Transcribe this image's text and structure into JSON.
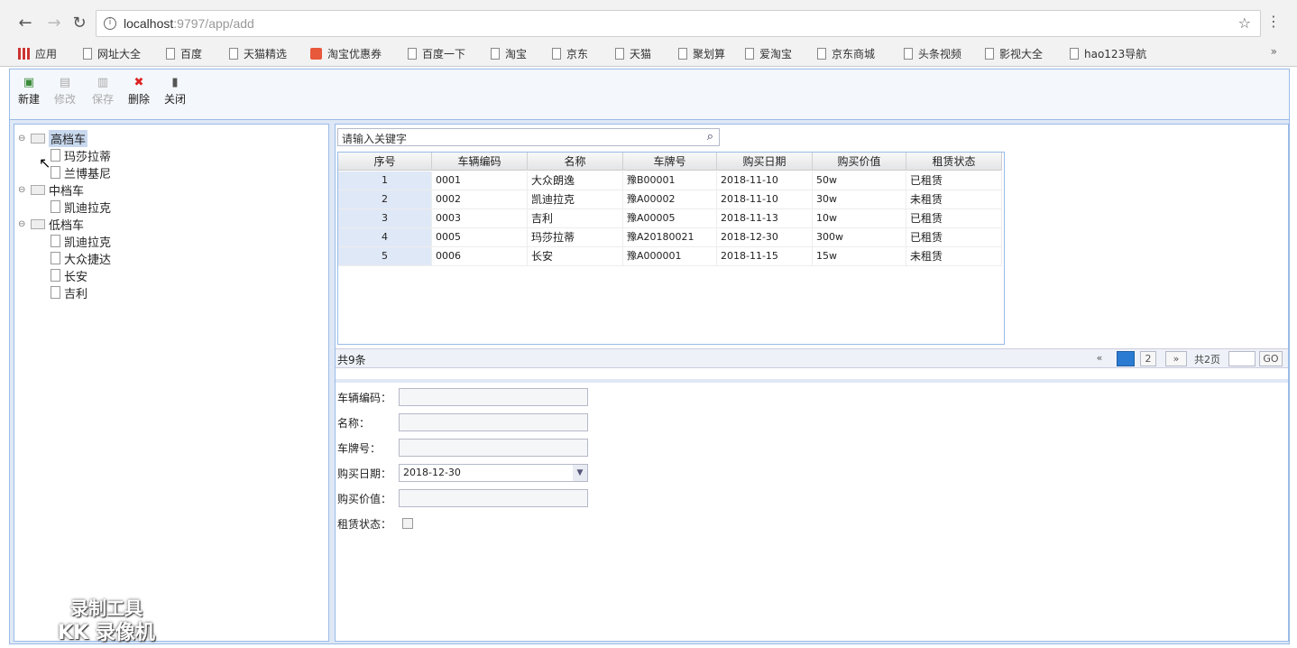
{
  "browser": {
    "url_host": "localhost",
    "url_path": ":9797/app/add",
    "bookmarks": [
      "应用",
      "网址大全",
      "百度",
      "天猫精选",
      "淘宝优惠券",
      "百度一下",
      "淘宝",
      "京东",
      "天猫",
      "聚划算",
      "爱淘宝",
      "京东商城",
      "头条视频",
      "影视大全",
      "hao123导航"
    ],
    "more": "»"
  },
  "toolbar": {
    "new": "新建",
    "edit": "修改",
    "save": "保存",
    "delete": "删除",
    "close": "关闭"
  },
  "tree": {
    "groups": [
      {
        "label": "高档车",
        "items": [
          "玛莎拉蒂",
          "兰博基尼"
        ]
      },
      {
        "label": "中档车",
        "items": [
          "凯迪拉克"
        ]
      },
      {
        "label": "低档车",
        "items": [
          "凯迪拉克",
          "大众捷达",
          "长安",
          "吉利"
        ]
      }
    ]
  },
  "search": {
    "placeholder": "请输入关键字"
  },
  "grid": {
    "columns": [
      "序号",
      "车辆编码",
      "名称",
      "车牌号",
      "购买日期",
      "购买价值",
      "租赁状态"
    ],
    "rows": [
      [
        "1",
        "0001",
        "大众朗逸",
        "豫B00001",
        "2018-11-10",
        "50w",
        "已租赁"
      ],
      [
        "2",
        "0002",
        "凯迪拉克",
        "豫A00002",
        "2018-11-10",
        "30w",
        "未租赁"
      ],
      [
        "3",
        "0003",
        "吉利",
        "豫A00005",
        "2018-11-13",
        "10w",
        "已租赁"
      ],
      [
        "4",
        "0005",
        "玛莎拉蒂",
        "豫A20180021",
        "2018-12-30",
        "300w",
        "已租赁"
      ],
      [
        "5",
        "0006",
        "长安",
        "豫A000001",
        "2018-11-15",
        "15w",
        "未租赁"
      ]
    ]
  },
  "pager": {
    "total": "共9条",
    "page2": "2",
    "next": "»",
    "pages": "共2页",
    "go": "GO"
  },
  "form": {
    "code_label": "车辆编码：",
    "name_label": "名称：",
    "plate_label": "车牌号：",
    "date_label": "购买日期：",
    "date_value": "2018-12-30",
    "price_label": "购买价值：",
    "status_label": "租赁状态："
  },
  "watermark": {
    "line1": "录制工具",
    "line2": "KK 录像机"
  }
}
